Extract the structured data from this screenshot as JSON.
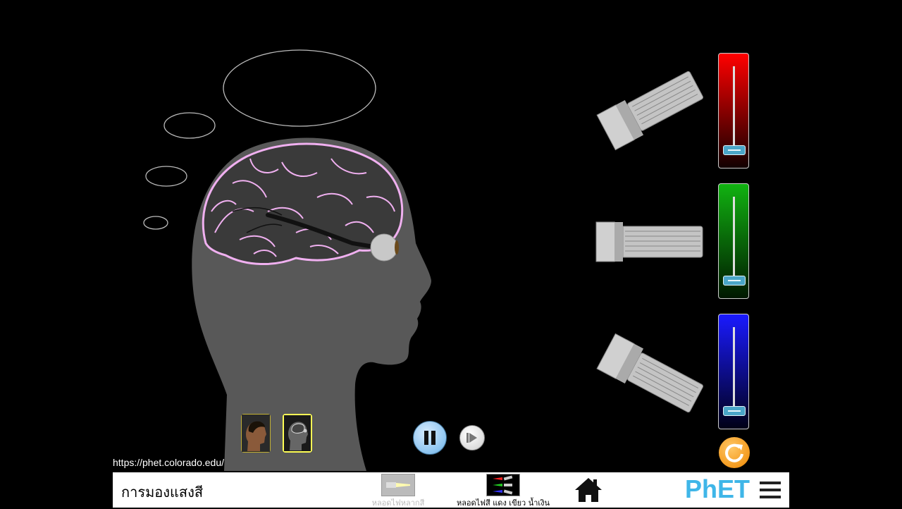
{
  "url": "https://phet.colorado.edu/",
  "navbar": {
    "title": "การมองแสงสี",
    "screens": [
      {
        "label": "หลอดไฟหลากสี"
      },
      {
        "label": "หลอดไฟสี แดง เขียว น้ำเงิน"
      }
    ],
    "logo": "PhET"
  },
  "sliders": {
    "red": {
      "color": "#ff0000",
      "value": 0
    },
    "green": {
      "color": "#00cc00",
      "value": 0
    },
    "blue": {
      "color": "#0000ff",
      "value": 0
    }
  },
  "icons": {
    "home": "home-icon",
    "menu": "hamburger-menu-icon",
    "reset": "reset-all-icon",
    "pause": "pause-icon",
    "step": "step-forward-icon"
  },
  "colors": {
    "head": "#585858",
    "brain_outline": "#f0b0f0",
    "phet_blue": "#3fb6e8",
    "reset_orange": "#f39a1e",
    "pause_blue": "#8cc4f0"
  }
}
